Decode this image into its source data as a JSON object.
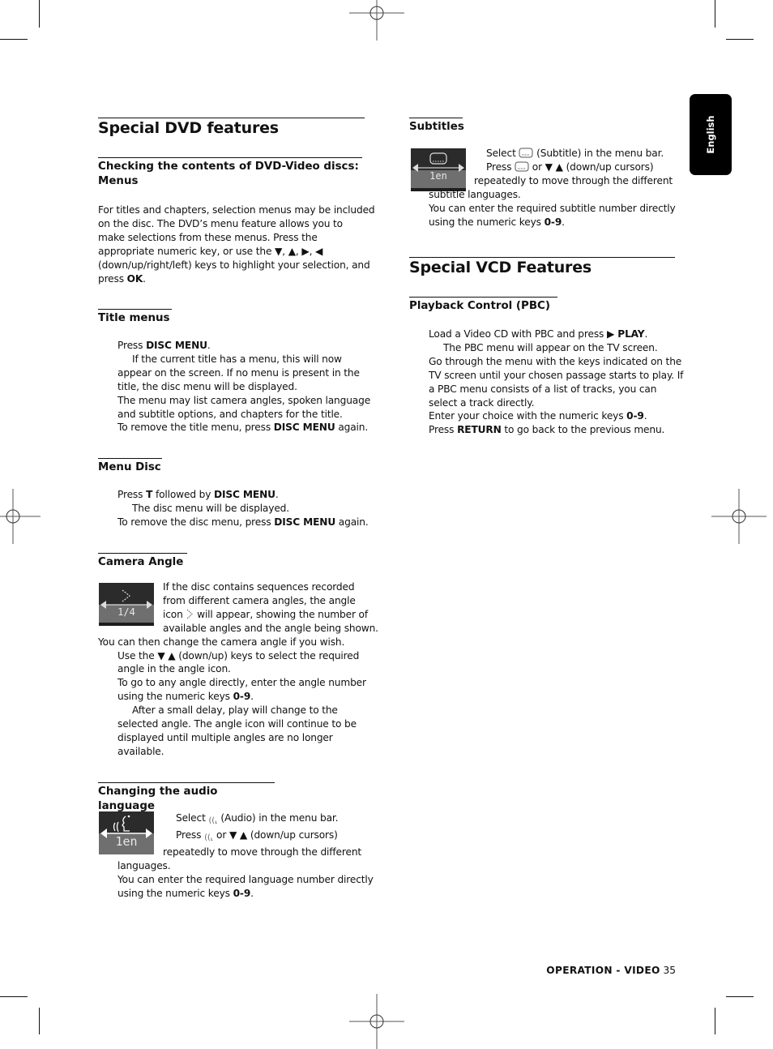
{
  "language_tab": "English",
  "left_column": {
    "title": "Special DVD features",
    "sections": [
      {
        "heading_lines": [
          "Checking the contents of DVD-Video discs:",
          "Menus"
        ],
        "lines": [
          "For titles and chapters, selection menus may be included",
          "on the disc. The DVD’s menu feature allows you to",
          "make selections from these menus. Press the",
          "appropriate numeric key, or use the ▼, ▲, ▶, ◀",
          "(down/up/right/left) keys to highlight your selection, and",
          "press ",
          "OK",
          "."
        ]
      },
      {
        "heading": "Title menus",
        "l1a": "Press ",
        "l1b": "DISC MENU",
        "l1c": ".",
        "l2": "If the current title has a menu, this will now",
        "l3": "appear on the screen. If no menu is present in the",
        "l4": "title, the disc menu will be displayed.",
        "l5": "The menu may list camera angles, spoken language",
        "l6": "and subtitle options, and chapters for the title.",
        "l7a": "To remove the title menu, press ",
        "l7b": "DISC MENU",
        "l7c": " again."
      },
      {
        "heading": "Menu Disc",
        "l1a": "Press ",
        "l1b": "T",
        "l1c": " followed by ",
        "l1d": "DISC MENU",
        "l1e": ".",
        "l2": "The disc menu will be displayed.",
        "l3a": "To remove the disc menu, press ",
        "l3b": "DISC MENU",
        "l3c": " again."
      },
      {
        "heading": "Camera Angle",
        "osd_value": "1/4",
        "l1": "If the disc contains sequences recorded",
        "l2": "from different camera angles, the angle",
        "l3a": "icon ",
        "l3b": " will appear, showing the number of",
        "l4": "available angles and the angle being shown.",
        "l5": "You can then change the camera angle if you wish.",
        "l6": "Use the ▼ ▲ (down/up) keys to select the required",
        "l7": "angle in the angle icon.",
        "l8": "To go to any angle directly, enter the angle number",
        "l9a": "using the numeric keys ",
        "l9b": "0-9",
        "l9c": ".",
        "l10": "After a small delay, play will change to the",
        "l11": "selected angle. The angle icon will continue to be",
        "l12": "displayed until multiple angles are no longer",
        "l13": "available."
      },
      {
        "heading": "Changing the audio language",
        "osd_value": "1en",
        "l1a": "Select ",
        "l1b": " (Audio) in the menu bar.",
        "l2a": "Press ",
        "l2b": " or ▼ ▲ (down/up cursors)",
        "l3": "repeatedly to move through the different",
        "l4": "languages.",
        "l5": "You can enter the required language number directly",
        "l6a": "using the numeric keys ",
        "l6b": "0-9",
        "l6c": "."
      }
    ]
  },
  "right_column": {
    "subtitles": {
      "heading": "Subtitles",
      "osd_value": "1en",
      "l1a": "Select ",
      "l1b": " (Subtitle) in the menu bar.",
      "l2a": "Press ",
      "l2b": " or ▼ ▲ (down/up cursors)",
      "l3": "repeatedly to move through the different",
      "l4": "subtitle languages.",
      "l5": "You can enter the required subtitle number directly",
      "l6a": "using the numeric keys ",
      "l6b": "0-9",
      "l6c": "."
    },
    "title": "Special VCD Features",
    "pbc": {
      "heading": "Playback Control (PBC)",
      "l1a": "Load a Video CD with PBC and press ",
      "l1b": "▶ PLAY",
      "l1c": ".",
      "l2": "The PBC menu will appear on the TV screen.",
      "l3": "Go through the menu with the keys indicated on the",
      "l4": "TV screen until your chosen passage starts to play. If",
      "l5": "a PBC menu consists of a list of tracks, you can",
      "l6": "select a track directly.",
      "l7a": "Enter your choice with the numeric keys ",
      "l7b": "0-9",
      "l7c": ".",
      "l8a": "Press ",
      "l8b": "RETURN",
      "l8c": " to go back to the previous menu."
    }
  },
  "footer": {
    "section": "OPERATION - VIDEO",
    "page_number": "35"
  }
}
